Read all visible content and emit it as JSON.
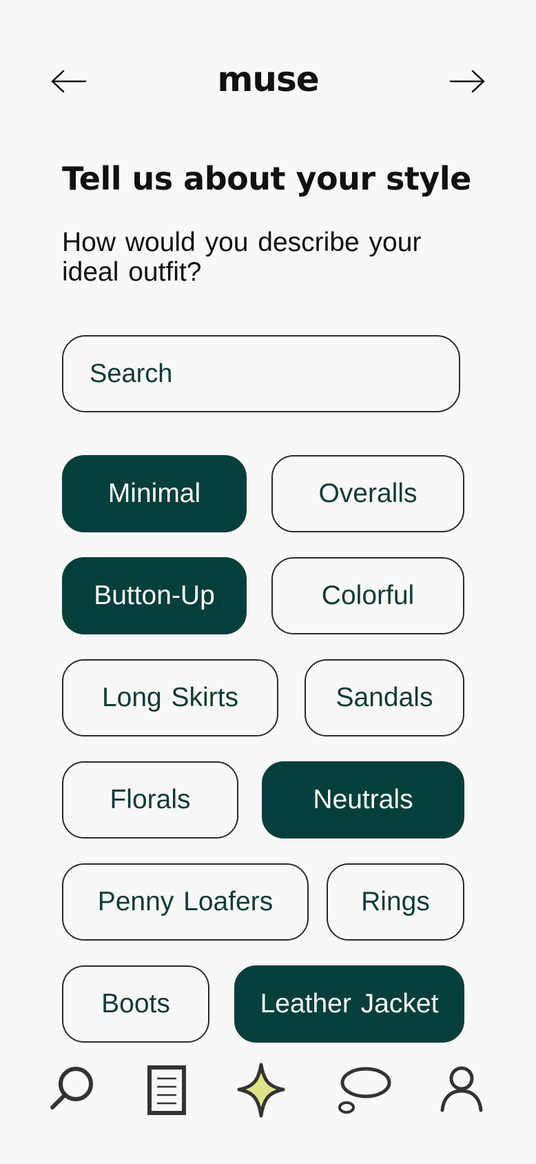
{
  "header": {
    "title": "muse",
    "back_icon": "arrow-left-icon",
    "forward_icon": "arrow-right-icon"
  },
  "main": {
    "heading": "Tell us about your style",
    "subheading": "How would you describe your ideal outfit?",
    "search": {
      "placeholder": "Search",
      "value": ""
    },
    "chips": [
      {
        "label": "Minimal",
        "selected": true
      },
      {
        "label": "Overalls",
        "selected": false
      },
      {
        "label": "Button-Up",
        "selected": true
      },
      {
        "label": "Colorful",
        "selected": false
      },
      {
        "label": "Long Skirts",
        "selected": false
      },
      {
        "label": "Sandals",
        "selected": false
      },
      {
        "label": "Florals",
        "selected": false
      },
      {
        "label": "Neutrals",
        "selected": true
      },
      {
        "label": "Penny Loafers",
        "selected": false
      },
      {
        "label": "Rings",
        "selected": false
      },
      {
        "label": "Boots",
        "selected": false
      },
      {
        "label": "Leather Jacket",
        "selected": true
      }
    ]
  },
  "bottom_nav": {
    "items": [
      {
        "icon": "search-icon"
      },
      {
        "icon": "document-icon"
      },
      {
        "icon": "sparkle-icon",
        "active": true
      },
      {
        "icon": "chat-bubble-icon"
      },
      {
        "icon": "profile-icon"
      }
    ]
  },
  "colors": {
    "accent": "#053f3b",
    "chip_text": "#0f3b37",
    "sparkle_fill": "#dfe48a",
    "background": "#f8f8f6",
    "border": "#2b2b2b"
  }
}
